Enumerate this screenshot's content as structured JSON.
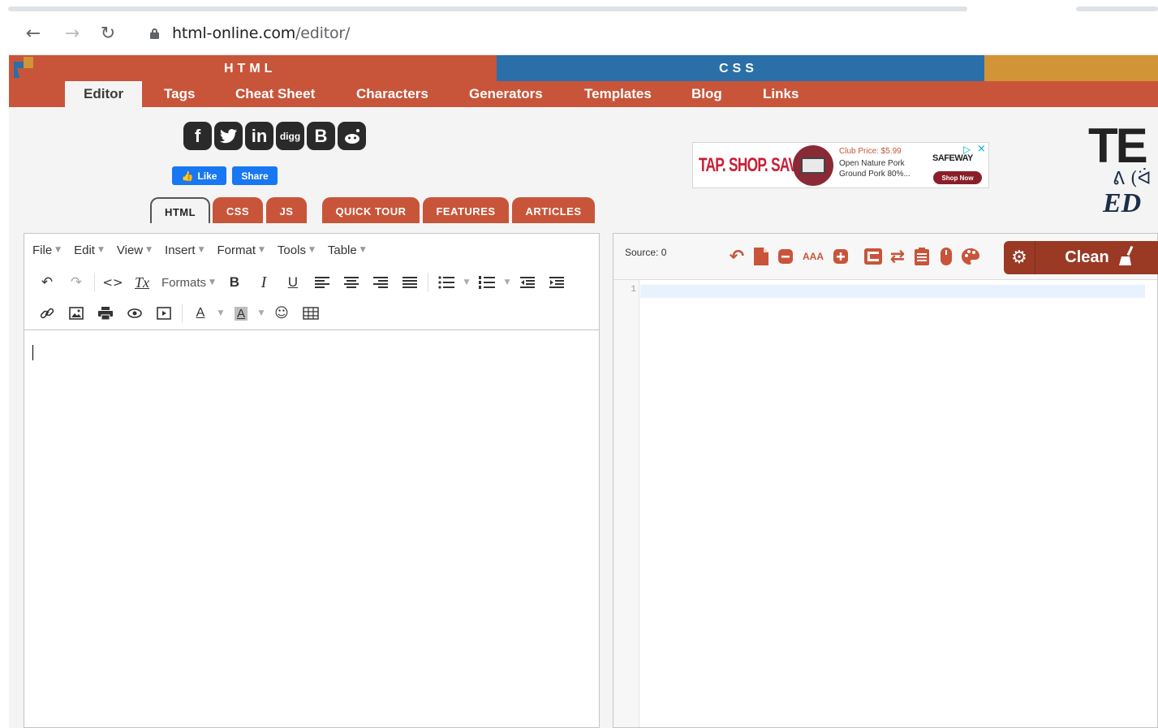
{
  "browser": {
    "url_domain": "html-online.com",
    "url_path": "/editor/"
  },
  "header": {
    "strip_html": "HTML",
    "strip_css": "CSS",
    "menu": [
      "Editor",
      "Tags",
      "Cheat Sheet",
      "Characters",
      "Generators",
      "Templates",
      "Blog",
      "Links"
    ],
    "active_menu": "Editor"
  },
  "social": {
    "icons": [
      "facebook-icon",
      "twitter-icon",
      "linkedin-icon",
      "digg-icon",
      "blogger-icon",
      "reddit-icon"
    ],
    "digg_text": "digg",
    "like_label": "Like",
    "share_label": "Share"
  },
  "tabs": {
    "html": "HTML",
    "css": "CSS",
    "js": "JS",
    "quick_tour": "QUICK TOUR",
    "features": "FEATURES",
    "articles": "ARTICLES"
  },
  "ad": {
    "headline": "TAP. SHOP. SAVE.",
    "price": "Club Price: $5.99",
    "desc": "Open Nature Pork Ground Pork 80%...",
    "brand": "SAFEWAY",
    "cta": "Shop Now"
  },
  "brand_logo": {
    "line1": "TE",
    "line2": "ᕕ (ᐛ",
    "line3": "ED"
  },
  "wysiwyg": {
    "menus": [
      "File",
      "Edit",
      "View",
      "Insert",
      "Format",
      "Tools",
      "Table"
    ],
    "formats_label": "Formats",
    "bold": "B",
    "italic": "I",
    "underline": "U",
    "code": "<>",
    "clear": "Tx",
    "font_color": "A",
    "bg_color": "A"
  },
  "source": {
    "label": "Source: 0",
    "text_size": "AAA",
    "clean_label": "Clean",
    "line_number": "1"
  },
  "colors": {
    "html_accent": "#c8553a",
    "css_accent": "#2a6fa8",
    "js_accent": "#d19436",
    "button_dark": "#9a3a25"
  }
}
